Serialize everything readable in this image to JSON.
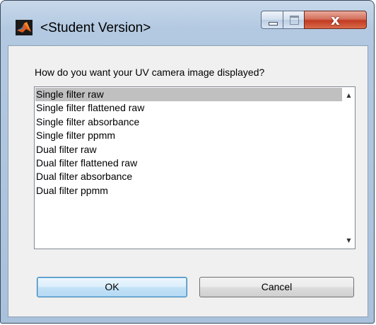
{
  "window": {
    "title": "<Student Version>",
    "close_glyph": "x"
  },
  "icons": {
    "app": "matlab-logo-icon",
    "minimize": "minimize-icon",
    "maximize": "maximize-icon",
    "close": "close-icon",
    "scroll_up": "scroll-up-arrow-icon",
    "scroll_down": "scroll-down-arrow-icon"
  },
  "dialog": {
    "prompt": "How do you want your UV camera image displayed?",
    "list_items": [
      "Single filter raw",
      "Single filter flattened raw",
      "Single filter absorbance",
      "Single filter ppmm",
      "Dual filter raw",
      "Dual filter flattened raw",
      "Dual filter absorbance",
      "Dual filter ppmm"
    ],
    "selected_item": "Single filter raw",
    "ok_label": "OK",
    "cancel_label": "Cancel"
  },
  "colors": {
    "selection": "#c0c0c0",
    "close_button": "#c23b22",
    "frame": "#b3c9e1"
  }
}
